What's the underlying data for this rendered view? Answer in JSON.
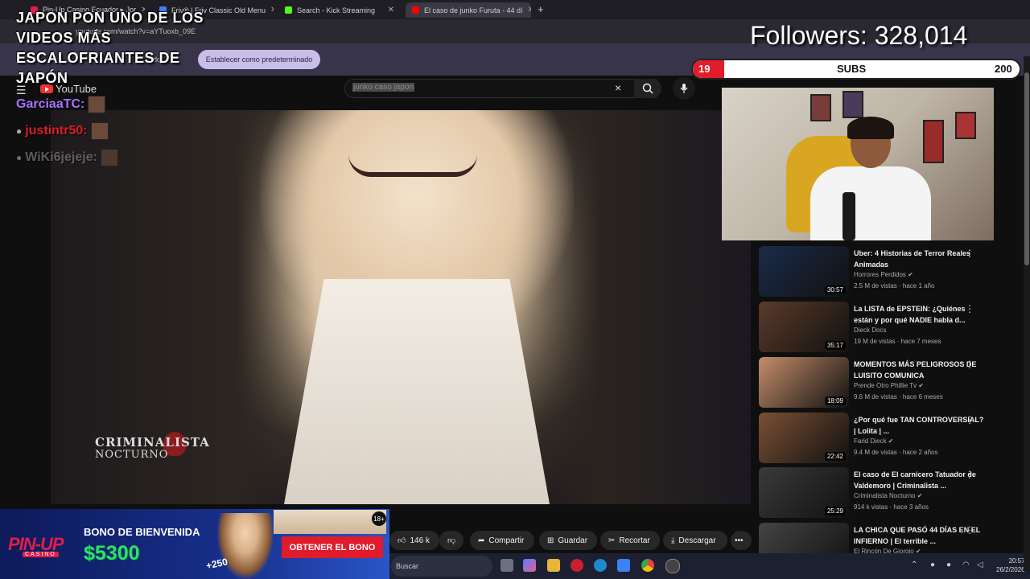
{
  "browser": {
    "tabs": [
      {
        "label": "Pin-Up Casino Ecuador ▸ Jor",
        "active": false
      },
      {
        "label": "Friv® | Friv Classic Old Menu",
        "active": false
      },
      {
        "label": "Search - Kick Streaming",
        "active": false
      },
      {
        "label": "El caso de junko Furuta - 44 dí",
        "active": true
      }
    ],
    "add_tab": "+",
    "address": "youtube.com/watch?v=aYTuoxb_09E",
    "infobar_text": "ado",
    "infobar_button": "Establecer como predeterminado"
  },
  "youtube": {
    "logo": "YouTube",
    "search_value": "junko caso japon",
    "clear_icon": "×",
    "actions": [
      {
        "label": "146 k",
        "icon": "thumb-up-icon"
      },
      {
        "label": "",
        "icon": "thumb-down-icon"
      },
      {
        "label": "Compartir",
        "icon": "share-icon"
      },
      {
        "label": "Guardar",
        "icon": "save-icon"
      },
      {
        "label": "Recortar",
        "icon": "clip-icon"
      },
      {
        "label": "Descargar",
        "icon": "download-icon"
      },
      {
        "label": "•••",
        "icon": "more-icon"
      }
    ],
    "video_watermark": {
      "line1": "CRIMINALISTA",
      "line2": "NOCTURNO"
    },
    "recommendations": [
      {
        "title": "Uber: 4 Historias de Terror Reales Animadas",
        "channel": "Horrores Perdidos ✔",
        "meta": "2.5 M de vistas · hace 1 año",
        "duration": "30:57",
        "color": "#1b2b4a"
      },
      {
        "title": "La LISTA de EPSTEIN: ¿Quiénes están y por qué NADIE habla d...",
        "channel": "Dieck Docs",
        "meta": "19 M de vistas · hace 7 meses",
        "duration": "35:17",
        "color": "#5a3b2a"
      },
      {
        "title": "MOMENTOS MÁS PELIGROSOS DE LUISITO COMUNICA",
        "channel": "Prende Otro Phillie Tv ✔",
        "meta": "9.6 M de vistas · hace 6 meses",
        "duration": "18:09",
        "color": "#c58d6a"
      },
      {
        "title": "¿Por qué fue TAN CONTROVERSIAL? | Lolita | ...",
        "channel": "Farid Dieck ✔",
        "meta": "9.4 M de vistas · hace 2 años",
        "duration": "22:42",
        "color": "#7a5034"
      },
      {
        "title": "El caso de El carnicero Tatuador de Valdemoro | Criminalista ...",
        "channel": "Criminalista Nocturno ✔",
        "meta": "914 k vistas · hace 3 años",
        "duration": "25:29",
        "color": "#3a3a3a"
      },
      {
        "title": "LA CHICA QUE PASÓ 44 DÍAS EN EL INFIERNO | El terrible ...",
        "channel": "El Rincón De Giorgio ✔",
        "meta": "",
        "duration": "",
        "color": "#444"
      }
    ]
  },
  "overlay": {
    "title": "JAPON PON UNO DE LOS VIDEOS MÁS ESCALOFRIANTES DE JAPÓN",
    "chat": [
      {
        "user": "GarciaaTC:",
        "color": "#a774ff"
      },
      {
        "user": "justintr50:",
        "color": "#d81e2a"
      },
      {
        "user": "WiKi6jejeje:",
        "color": "#8c8c8c"
      }
    ],
    "followers": "Followers: 328,014",
    "subs": {
      "current": "19",
      "label": "SUBS",
      "goal": "200",
      "progress": 0.095
    }
  },
  "ad": {
    "brand": "PIN-UP",
    "brand_sub": "CASINO",
    "headline": "BONO DE BIENVENIDA",
    "amount": "$5300",
    "cta": "OBTENER EL BONO",
    "badge": "18+",
    "chip": "+250"
  },
  "taskbar": {
    "search": "Buscar",
    "time": "20:57",
    "date": "26/2/2026"
  }
}
